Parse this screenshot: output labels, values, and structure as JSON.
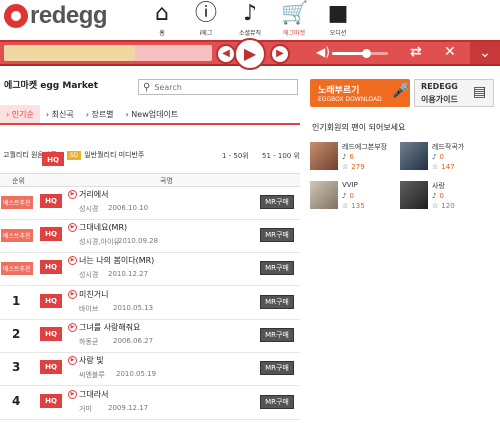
{
  "brand": {
    "logo_text": "redegg"
  },
  "nav": [
    {
      "label": "홈",
      "icon": "home-icon",
      "glyph": "⌂"
    },
    {
      "label": "i에그",
      "icon": "info-icon",
      "glyph": "ⓘ"
    },
    {
      "label": "소셜뮤직",
      "icon": "music-note-icon",
      "glyph": "♪"
    },
    {
      "label": "에그마켓",
      "icon": "shopping-cart-icon",
      "glyph": "🛒"
    },
    {
      "label": "오디션",
      "icon": "video-camera-icon",
      "glyph": "■"
    }
  ],
  "player": {
    "progress": 0.63,
    "volume": 0.6,
    "prev_icon": "previous-icon",
    "play_icon": "play-icon",
    "next_icon": "next-icon",
    "repeat_icon": "repeat-icon",
    "shuffle_icon": "shuffle-icon",
    "menu_icon": "chevron-down-icon"
  },
  "market": {
    "title": "에그마켓 egg Market"
  },
  "search": {
    "placeholder": "Search"
  },
  "tabs": [
    "인기순",
    "최신곡",
    "장르별",
    "New업데이트"
  ],
  "filters": {
    "hq_badge": "HQ",
    "hq_label": "고퀄리티 원음반주",
    "sd_badge": "SD",
    "sd_label": "일반퀄리티 미디반주",
    "range1": "1 - 50위",
    "range2": "51 - 100 위"
  },
  "table": {
    "col_rank": "순위",
    "col_title": "곡명",
    "rows": [
      {
        "rank": "",
        "badge": "베스트추천",
        "quality": "HQ",
        "title": "거리에서",
        "artist": "성시경",
        "date": "2006.10.10",
        "action": "MR구매"
      },
      {
        "rank": "",
        "badge": "베스트추천",
        "quality": "HQ",
        "title": "그대네요(MR)",
        "artist": "성시경,아이유",
        "date": "2010.09.28",
        "action": "MR구매"
      },
      {
        "rank": "",
        "badge": "베스트추천",
        "quality": "HQ",
        "title": "너는 나의 봄이다(MR)",
        "artist": "성시경",
        "date": "2010.12.27",
        "action": "MR구매"
      },
      {
        "rank": "1",
        "badge": "",
        "quality": "HQ",
        "title": "미친거니",
        "artist": "바이브",
        "date": "2010.05.13",
        "action": "MR구매"
      },
      {
        "rank": "2",
        "badge": "",
        "quality": "HQ",
        "title": "그녀를 사랑해줘요",
        "artist": "하동균",
        "date": "2006.06.27",
        "action": "MR구매"
      },
      {
        "rank": "3",
        "badge": "",
        "quality": "HQ",
        "title": "사랑 빛",
        "artist": "씨엔블루",
        "date": "2010.05.19",
        "action": "MR구매"
      },
      {
        "rank": "4",
        "badge": "",
        "quality": "HQ",
        "title": "그대라서",
        "artist": "거미",
        "date": "2009.12.17",
        "action": "MR구매"
      }
    ]
  },
  "banners": {
    "karaoke_title": "노래부르기",
    "karaoke_sub": "EGGBOX DOWNLOAD",
    "guide_title": "REDEGG",
    "guide_sub": "이용가이드"
  },
  "popular": {
    "title": "인기회원의 팬이 되어보세요",
    "members": [
      {
        "name": "레드에그본부장",
        "notes": "6",
        "stars": "279"
      },
      {
        "name": "레드작곡가",
        "notes": "0",
        "stars": "147"
      },
      {
        "name": "VVIP",
        "notes": "0",
        "stars": "135"
      },
      {
        "name": "사랑",
        "notes": "0",
        "stars": "120"
      }
    ]
  }
}
